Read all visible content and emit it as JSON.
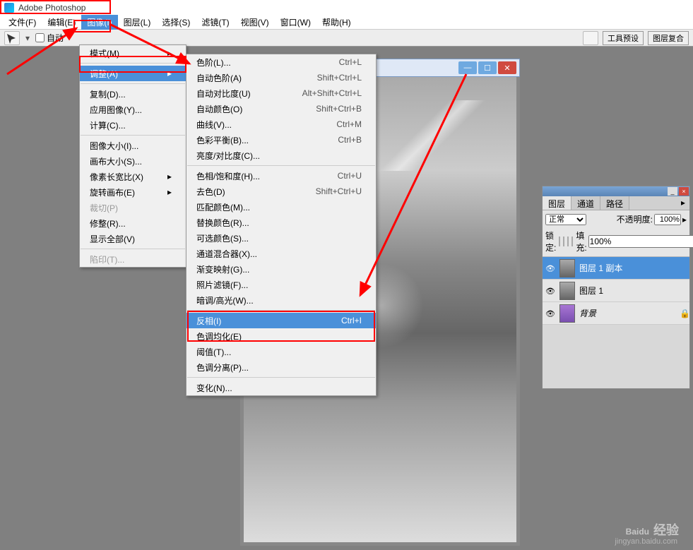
{
  "app_title": "Adobe Photoshop",
  "menubar": {
    "file": "文件(F)",
    "edit": "编辑(E)",
    "image": "图像(I)",
    "layer": "图层(L)",
    "select": "选择(S)",
    "filter": "滤镜(T)",
    "view": "视图(V)",
    "window": "窗口(W)",
    "help": "帮助(H)"
  },
  "toolbar": {
    "auto": "自动",
    "tool_preset": "工具预设",
    "layer_comps": "图层复合"
  },
  "image_menu": {
    "mode": "模式(M)",
    "adjust": "调整(A)",
    "duplicate": "复制(D)...",
    "apply_image": "应用图像(Y)...",
    "calc": "计算(C)...",
    "image_size": "图像大小(I)...",
    "canvas_size": "画布大小(S)...",
    "pixel_aspect": "像素长宽比(X)",
    "rotate_canvas": "旋转画布(E)",
    "crop": "裁切(P)",
    "trim": "修整(R)...",
    "reveal_all": "显示全部(V)",
    "trap": "陷印(T)..."
  },
  "adjust_menu": [
    {
      "label": "色阶(L)...",
      "sc": "Ctrl+L"
    },
    {
      "label": "自动色阶(A)",
      "sc": "Shift+Ctrl+L"
    },
    {
      "label": "自动对比度(U)",
      "sc": "Alt+Shift+Ctrl+L"
    },
    {
      "label": "自动颜色(O)",
      "sc": "Shift+Ctrl+B"
    },
    {
      "label": "曲线(V)...",
      "sc": "Ctrl+M"
    },
    {
      "label": "色彩平衡(B)...",
      "sc": "Ctrl+B"
    },
    {
      "label": "亮度/对比度(C)...",
      "sc": ""
    },
    {
      "sep": true
    },
    {
      "label": "色相/饱和度(H)...",
      "sc": "Ctrl+U"
    },
    {
      "label": "去色(D)",
      "sc": "Shift+Ctrl+U"
    },
    {
      "label": "匹配颜色(M)...",
      "sc": ""
    },
    {
      "label": "替换颜色(R)...",
      "sc": ""
    },
    {
      "label": "可选颜色(S)...",
      "sc": ""
    },
    {
      "label": "通道混合器(X)...",
      "sc": ""
    },
    {
      "label": "渐变映射(G)...",
      "sc": ""
    },
    {
      "label": "照片滤镜(F)...",
      "sc": ""
    },
    {
      "label": "暗调/高光(W)...",
      "sc": ""
    },
    {
      "sep": true
    },
    {
      "label": "反相(I)",
      "sc": "Ctrl+I",
      "hl": true
    },
    {
      "label": "色调均化(E)",
      "sc": ""
    },
    {
      "label": "阈值(T)...",
      "sc": ""
    },
    {
      "label": "色调分离(P)...",
      "sc": ""
    },
    {
      "sep": true
    },
    {
      "label": "变化(N)...",
      "sc": ""
    }
  ],
  "layers_panel": {
    "tabs": {
      "layers": "图层",
      "channels": "通道",
      "paths": "路径"
    },
    "blend_mode": "正常",
    "opacity_label": "不透明度:",
    "opacity_value": "100%",
    "lock_label": "锁定:",
    "fill_label": "填充:",
    "fill_value": "100%",
    "layers": [
      {
        "name": "图层 1 副本",
        "selected": true
      },
      {
        "name": "图层 1",
        "selected": false
      },
      {
        "name": "背景",
        "selected": false,
        "italic": true,
        "locked": true
      }
    ]
  },
  "watermark": {
    "brand": "Baidu",
    "suffix": "经验",
    "url": "jingyan.baidu.com"
  }
}
